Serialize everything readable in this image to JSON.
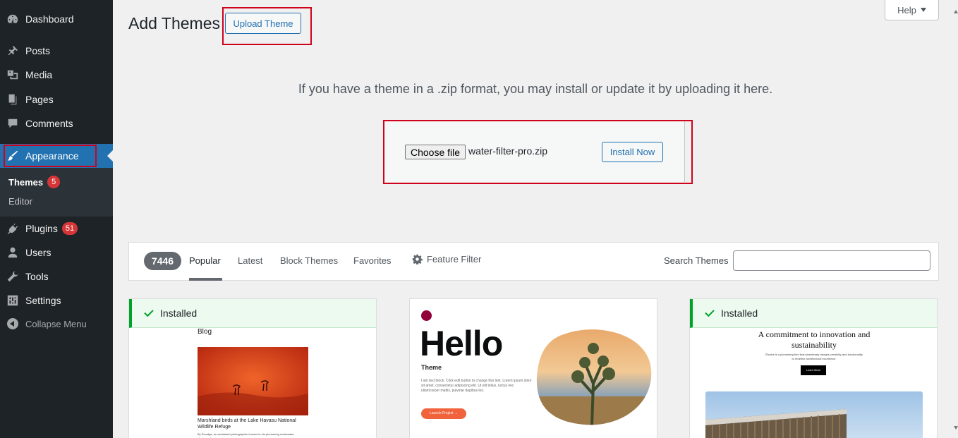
{
  "sidebar": {
    "items": [
      {
        "label": "Dashboard"
      },
      {
        "label": "Posts"
      },
      {
        "label": "Media"
      },
      {
        "label": "Pages"
      },
      {
        "label": "Comments"
      },
      {
        "label": "Appearance"
      },
      {
        "label": "Plugins",
        "badge": "51"
      },
      {
        "label": "Users"
      },
      {
        "label": "Tools"
      },
      {
        "label": "Settings"
      }
    ],
    "submenu": [
      {
        "label": "Themes",
        "badge": "5"
      },
      {
        "label": "Editor"
      }
    ],
    "collapse_label": "Collapse Menu"
  },
  "header": {
    "title": "Add Themes",
    "upload_button": "Upload Theme",
    "help_button": "Help"
  },
  "upload": {
    "description": "If you have a theme in a .zip format, you may install or update it by uploading it here.",
    "choose_button": "Choose file",
    "file_name": "water-filter-pro.zip",
    "install_button": "Install Now"
  },
  "filter_bar": {
    "count": "7446",
    "tabs": [
      {
        "label": "Popular"
      },
      {
        "label": "Latest"
      },
      {
        "label": "Block Themes"
      },
      {
        "label": "Favorites"
      }
    ],
    "feature_filter": "Feature Filter",
    "search_label": "Search Themes"
  },
  "themes": [
    {
      "installed_label": "Installed",
      "preview": {
        "heading": "Blog",
        "caption": "Marshland birds at the Lake Havasu National Wildlife Refuge",
        "text": "By Smudge, an acclaimed photographer known for his pioneering underwater photography"
      }
    },
    {
      "preview": {
        "heading": "Hello",
        "subheading": "Theme",
        "text": "I am text block. Click edit button to change this text. Lorem ipsum dolor sit amet, consectetur adipiscing elit. Ut elit tellus, luctus nec ullamcorper mattis, pulvinar dapibus leo.",
        "cta": "Launch Project →"
      }
    },
    {
      "installed_label": "Installed",
      "preview": {
        "heading": "A commitment to innovation and sustainability",
        "text": "Études is a pioneering firm that seamlessly merges creativity and functionality to redefine architectural excellence.",
        "cta": "Learn More"
      }
    }
  ],
  "colors": {
    "sidebar_bg": "#1d2327",
    "accent": "#2271b1",
    "highlight": "#d0021b",
    "installed_green": "#00a32a",
    "badge_red": "#d63638"
  }
}
